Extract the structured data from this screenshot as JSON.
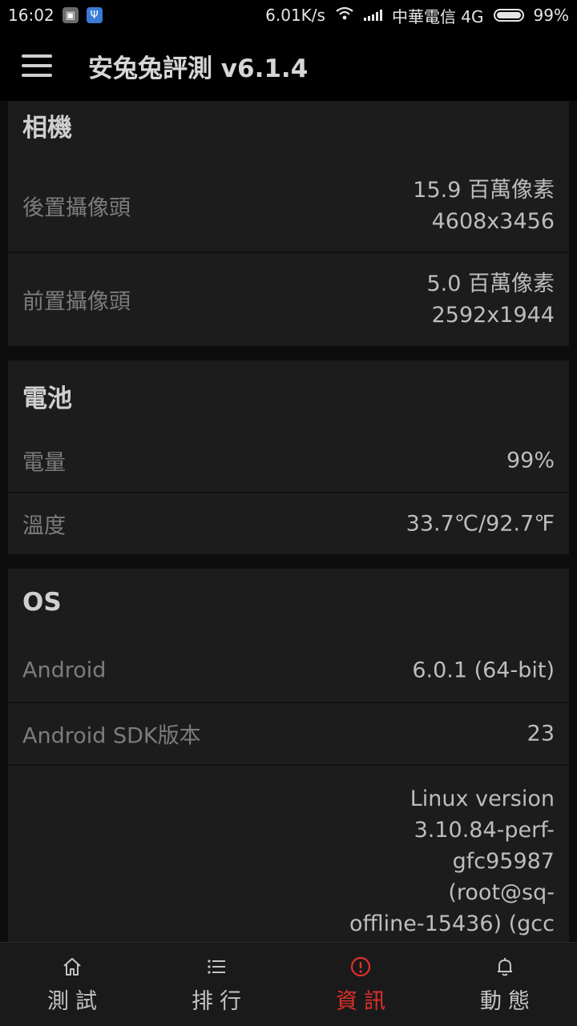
{
  "statusbar": {
    "time": "16:02",
    "speed": "6.01K/s",
    "carrier": "中華電信 4G",
    "battery": "99%"
  },
  "appbar": {
    "title": "安兔兔評測 v6.1.4"
  },
  "camera": {
    "title": "相機",
    "rear_label": "後置攝像頭",
    "rear_value_1": "15.9 百萬像素",
    "rear_value_2": "4608x3456",
    "front_label": "前置攝像頭",
    "front_value_1": "5.0 百萬像素",
    "front_value_2": "2592x1944"
  },
  "battery_card": {
    "title": "電池",
    "level_label": "電量",
    "level_value": "99%",
    "temp_label": "溫度",
    "temp_value": "33.7℃/92.7℉"
  },
  "os": {
    "title": "OS",
    "android_label": "Android",
    "android_value": "6.0.1 (64-bit)",
    "sdk_label": "Android SDK版本",
    "sdk_value": "23",
    "kernel_lines": [
      "Linux version",
      "3.10.84-perf-",
      "gfc95987",
      "(root@sq-",
      "offline-15436) (gcc"
    ]
  },
  "bottomnav": {
    "items": [
      {
        "label": "測試",
        "icon": "home-icon"
      },
      {
        "label": "排行",
        "icon": "list-icon"
      },
      {
        "label": "資訊",
        "icon": "info-icon"
      },
      {
        "label": "動態",
        "icon": "bell-icon"
      }
    ],
    "active_color": "#e0302a"
  }
}
